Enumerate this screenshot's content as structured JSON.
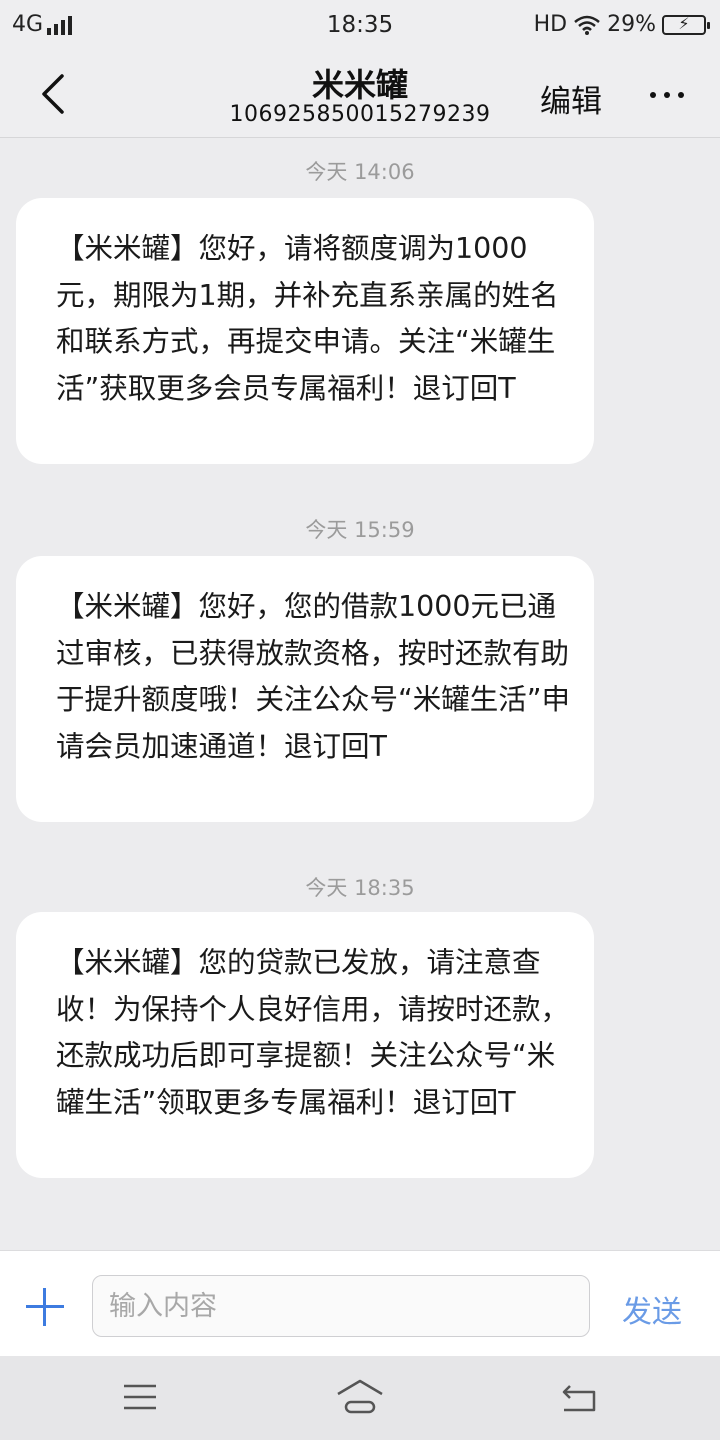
{
  "status_bar": {
    "network": "4G",
    "time": "18:35",
    "hd": "HD",
    "battery_percent": "29%"
  },
  "header": {
    "title": "米米罐",
    "subtitle": "106925850015279239",
    "edit_label": "编辑",
    "icons": [
      "back-icon",
      "more-icon"
    ]
  },
  "messages": [
    {
      "timestamp": "今天 14:06",
      "text": "【米米罐】您好，请将额度调为1000元，期限为1期，并补充直系亲属的姓名和联系方式，再提交申请。关注“米罐生活”获取更多会员专属福利！退订回T"
    },
    {
      "timestamp": "今天 15:59",
      "text": "【米米罐】您好，您的借款1000元已通过审核，已获得放款资格，按时还款有助于提升额度哦！关注公众号“米罐生活”申请会员加速通道！退订回T"
    },
    {
      "timestamp": "今天 18:35",
      "text": "【米米罐】您的贷款已发放，请注意查收！为保持个人良好信用，请按时还款，还款成功后即可享提额！关注公众号“米罐生活”领取更多专属福利！退订回T"
    }
  ],
  "input_bar": {
    "placeholder": "输入内容",
    "value": "",
    "send_label": "发送"
  },
  "nav_bar": {
    "icons": [
      "menu-icon",
      "home-icon",
      "return-icon"
    ]
  },
  "colors": {
    "background": "#ececee",
    "bubble": "#ffffff",
    "accent": "#3d7be0",
    "send": "#6a9be6",
    "timestamp": "#9b9b9b"
  }
}
